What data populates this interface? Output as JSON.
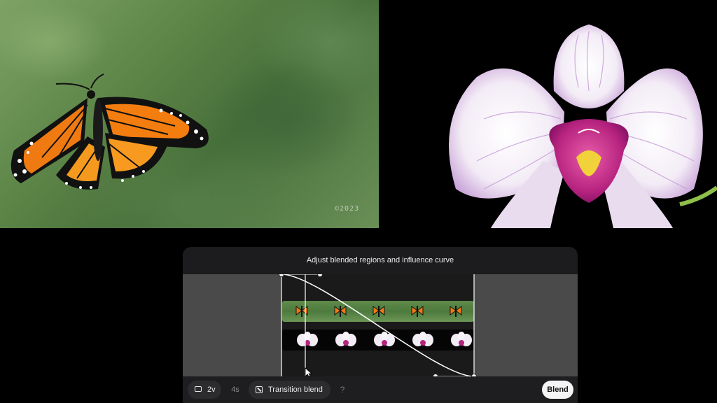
{
  "preview": {
    "left_watermark": "©2023"
  },
  "panel": {
    "title": "Adjust blended regions and influence curve"
  },
  "toolbar": {
    "speed_label": "2v",
    "duration_label": "4s",
    "transition_label": "Transition blend",
    "help_label": "?",
    "blend_label": "Blend"
  },
  "icons": {
    "speed": "speed-box-icon",
    "transition": "transition-blend-icon",
    "cursor": "mouse-pointer-icon"
  },
  "colors": {
    "panel_bg": "#1c1c1e",
    "gray_region": "#4a4a4a",
    "curve": "#ffffff",
    "blend_button": "#f5f5f5"
  }
}
